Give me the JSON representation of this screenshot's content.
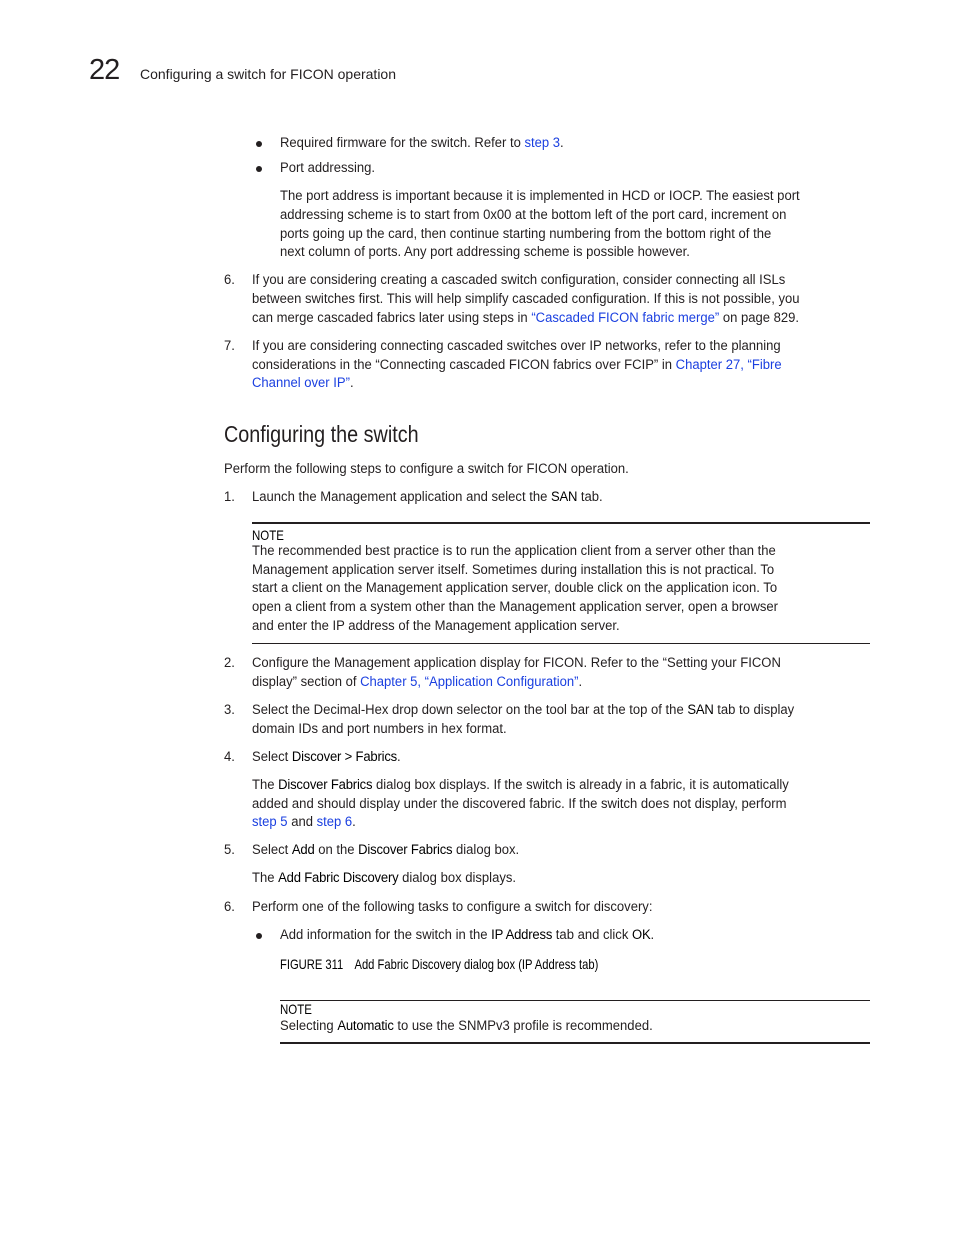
{
  "header": {
    "chapter_number": "22",
    "chapter_title": "Configuring a switch for FICON operation"
  },
  "intro_bullets": [
    {
      "text_before": "Required firmware for the switch. Refer to ",
      "link": "step 3",
      "text_after": "."
    },
    {
      "text": "Port addressing."
    }
  ],
  "port_addressing_para": [
    "The port address is important because it is implemented in HCD or IOCP. The easiest port",
    "addressing scheme is to start from 0x00 at the bottom left of the port card, increment on",
    "ports going up the card, then continue starting numbering from the bottom right of the",
    "next column of ports. Any port addressing scheme is possible however."
  ],
  "pre_steps": [
    {
      "number": "6.",
      "line1": "If you are considering creating a cascaded switch configuration, consider connecting all ISLs",
      "line2": "between switches first. This will help simplify cascaded configuration. If this is not possible, you",
      "line3_before": "can merge cascaded fabrics later using steps in ",
      "line3_link": "“Cascaded FICON fabric merge”",
      "line3_after": " on page 829."
    },
    {
      "number": "7.",
      "line1": "If you are considering connecting cascaded switches over IP networks, refer to the planning",
      "line2_before": "considerations in the “Connecting cascaded FICON fabrics over FCIP” in ",
      "line2_link": "Chapter 27, “Fibre",
      "line3_link": "Channel over IP”",
      "line3_after": "."
    }
  ],
  "section": {
    "heading": "Configuring the switch",
    "intro": "Perform the following steps to configure a switch for FICON operation."
  },
  "steps": {
    "s1": {
      "number": "1.",
      "before": "Launch the Management application and select the ",
      "bold": "SAN",
      "after": " tab."
    },
    "note1": {
      "label": "NOTE",
      "lines": [
        "The recommended best practice is to run the application client from a server other than the",
        "Management application server itself. Sometimes during installation this is not practical. To",
        "start a client on the Management application server, double click on the application icon. To",
        "open a client from a system other than the Management application server, open a browser",
        "and enter the IP address of the Management application server."
      ]
    },
    "s2": {
      "number": "2.",
      "line1": "Configure the Management application display for FICON. Refer to the “Setting your FICON",
      "line2_before": "display” section of ",
      "line2_link": "Chapter 5, “Application Configuration”",
      "line2_after": "."
    },
    "s3": {
      "number": "3.",
      "line1_before": "Select the Decimal-Hex drop down selector on the tool bar at the top of the ",
      "line1_bold": "SAN",
      "line1_after": " tab to display",
      "line2": "domain IDs and port numbers in hex format."
    },
    "s4": {
      "number": "4.",
      "before": "Select ",
      "bold": "Discover > Fabrics",
      "after": "."
    },
    "s4_para": {
      "l1_before": "The ",
      "l1_bold": "Discover Fabrics",
      "l1_after": " dialog box displays. If the switch is already in a fabric, it is automatically",
      "l2": "added and should display under the discovered fabric. If the switch does not display, perform",
      "l3_link1": "step 5",
      "l3_mid": " and ",
      "l3_link2": "step 6",
      "l3_after": "."
    },
    "s5": {
      "number": "5.",
      "before": "Select ",
      "bold1": "Add",
      "mid": " on the ",
      "bold2": "Discover Fabrics",
      "after": " dialog box."
    },
    "s5_para": {
      "before": "The ",
      "bold": "Add Fabric Discovery",
      "after": " dialog box displays."
    },
    "s6": {
      "number": "6.",
      "text": "Perform one of the following tasks to configure a switch for discovery:"
    },
    "s6_bullet": {
      "before": "Add information for the switch in the ",
      "bold1": "IP Address",
      "mid": " tab and click ",
      "bold2": "OK",
      "after": "."
    },
    "figure": {
      "label": "FIGURE 311",
      "caption": "Add Fabric Discovery dialog box (IP Address tab)"
    },
    "note2": {
      "label": "NOTE",
      "before": "Selecting ",
      "bold": "Automatic",
      "after": " to use the SNMPv3 profile is recommended."
    }
  }
}
